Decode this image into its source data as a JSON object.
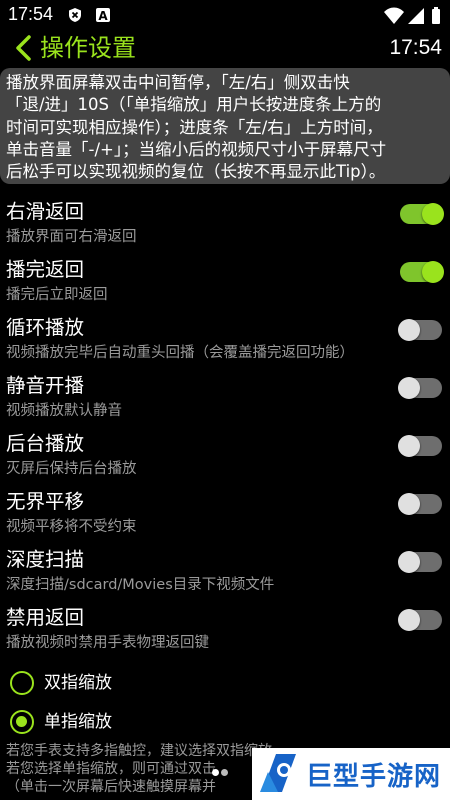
{
  "status_bar": {
    "time": "17:54",
    "icons": [
      "shield-x-icon",
      "letter-a-icon",
      "wifi-icon",
      "signal-icon",
      "battery-icon"
    ],
    "a_badge": "A"
  },
  "app_bar": {
    "back_icon": "chevron-left-icon",
    "title": "操作设置",
    "clock": "17:54",
    "accent_color": "#9ae31d"
  },
  "tip": {
    "lines": [
      "播放界面屏幕双击中间暂停，「左/右」侧双击快",
      "「退/进」10S（「单指缩放」用户长按进度条上方的",
      "时间可实现相应操作）；进度条「左/右」上方时间，",
      "单击音量「-/+」；当缩小后的视频尺寸小于屏幕尺寸",
      "后松手可以实现视频的复位（长按不再显示此Tip）。"
    ]
  },
  "settings": [
    {
      "title": "右滑返回",
      "subtitle": "播放界面可右滑返回",
      "on": true
    },
    {
      "title": "播完返回",
      "subtitle": "播完后立即返回",
      "on": true
    },
    {
      "title": "循环播放",
      "subtitle": "视频播放完毕后自动重头回播（会覆盖播完返回功能）",
      "on": false
    },
    {
      "title": "静音开播",
      "subtitle": "视频播放默认静音",
      "on": false
    },
    {
      "title": "后台播放",
      "subtitle": "灭屏后保持后台播放",
      "on": false
    },
    {
      "title": "无界平移",
      "subtitle": "视频平移将不受约束",
      "on": false
    },
    {
      "title": "深度扫描",
      "subtitle": "深度扫描/sdcard/Movies目录下视频文件",
      "on": false
    },
    {
      "title": "禁用返回",
      "subtitle": "播放视频时禁用手表物理返回键",
      "on": false
    }
  ],
  "zoom_mode": {
    "options": [
      {
        "label": "双指缩放",
        "selected": false
      },
      {
        "label": "单指缩放",
        "selected": true
      }
    ]
  },
  "note": {
    "lines": [
      "若您手表支持多指触控，建议选择双指缩放",
      "若您选择单指缩放，则可通过双击",
      "（单击一次屏幕后快速触摸屏幕并"
    ]
  },
  "watermark": {
    "text": "巨型手游网",
    "color": "#1763c7"
  },
  "colors": {
    "background": "#000000",
    "tip_background": "#444444",
    "switch_on": "#9ae31d",
    "switch_off": "#6e6e6e",
    "subtitle": "#9a9a9a"
  }
}
